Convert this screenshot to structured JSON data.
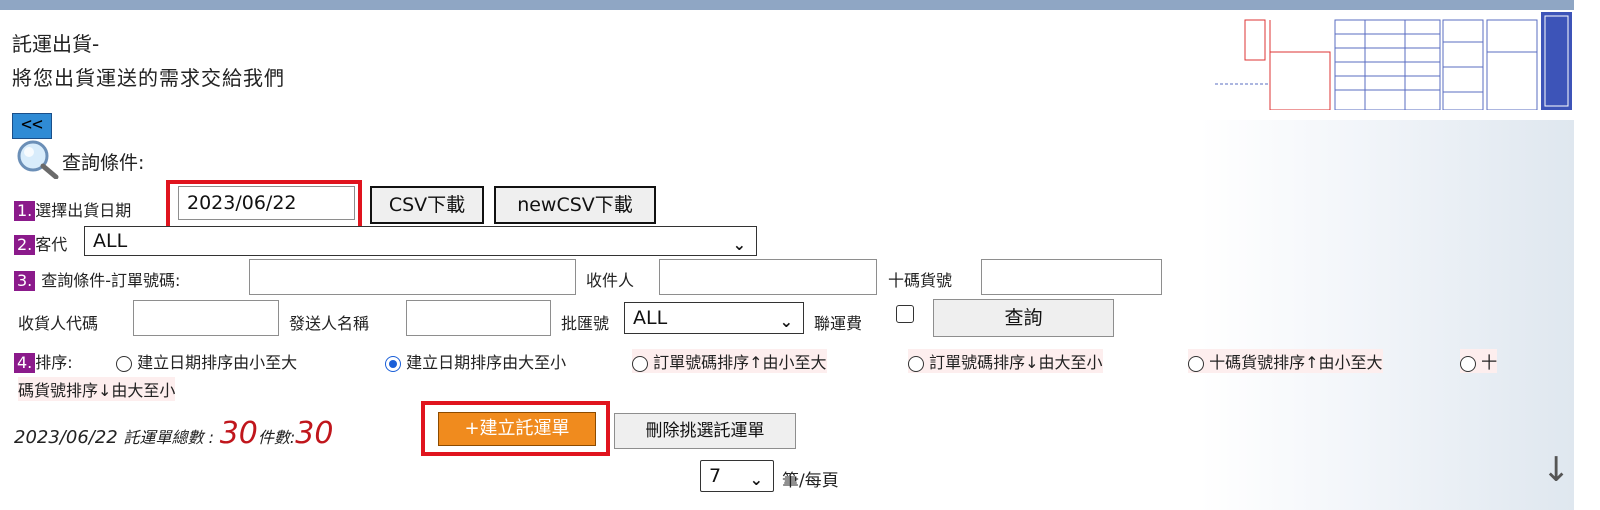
{
  "header": {
    "ghost_title": "",
    "title_line1": "託運出貨-",
    "title_line2": "將您出貨運送的需求交給我們"
  },
  "nav": {
    "back_label": "<<"
  },
  "query": {
    "title": "查詢條件:",
    "step1": {
      "num": "1.",
      "label": "選擇出貨日期",
      "date_value": "2023/06/22",
      "csv_label": "CSV下載",
      "newcsv_label": "newCSV下載"
    },
    "step2": {
      "num": "2.",
      "label": "客代",
      "select_value": "ALL"
    },
    "step3": {
      "num": "3.",
      "order_label": "查詢條件-訂單號碼:",
      "receiver_label": "收件人",
      "ten_code_label": "十碼貨號",
      "receiver_code_label": "收貨人代碼",
      "sender_name_label": "發送人名稱",
      "batch_label": "批匯號",
      "batch_value": "ALL",
      "joint_fee_label": "聯運費",
      "search_button": "查詢"
    },
    "step4": {
      "num": "4.",
      "label": "排序:",
      "options": [
        {
          "label": "建立日期排序由小至大",
          "checked": false
        },
        {
          "label": "建立日期排序由大至小",
          "checked": true
        },
        {
          "label": "訂單號碼排序↑由小至大",
          "checked": false
        },
        {
          "label": "訂單號碼排序↓由大至小",
          "checked": false
        },
        {
          "label": "十碼貨號排序↑由小至大",
          "checked": false
        },
        {
          "label": "十",
          "checked": false
        }
      ],
      "wrap_text": "碼貨號排序↓由大至小"
    }
  },
  "summary": {
    "date": "2023/06/22",
    "total_label": "託運單總數 :",
    "total_value": "30",
    "count_label": "件數:",
    "count_value": "30",
    "create_button": "+建立託運單",
    "delete_button": "刪除挑選託運單"
  },
  "pager": {
    "per_page_value": "7",
    "per_page_label": "筆/每頁"
  },
  "colors": {
    "highlight": "#e0141e",
    "step_badge": "#8b1a8b",
    "create_button": "#f08b1e",
    "accent_blue": "#2f8bd5"
  },
  "icons": {
    "search": "magnifier-icon",
    "scroll_down": "arrow-down-icon"
  }
}
